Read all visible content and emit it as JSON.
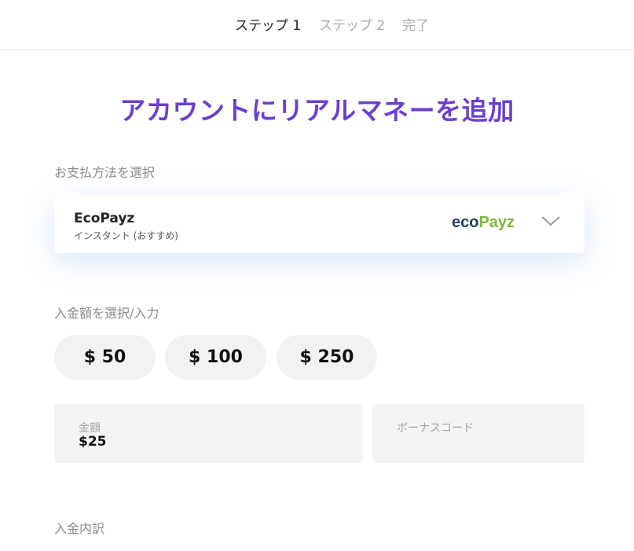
{
  "steps": [
    {
      "label": "ステップ 1",
      "active": true
    },
    {
      "label": "ステップ 2",
      "active": false
    },
    {
      "label": "完了",
      "active": false
    }
  ],
  "title": "アカウントにリアルマネーを追加",
  "payment": {
    "section_label": "お支払方法を選択",
    "method_name": "EcoPayz",
    "method_sub": "インスタント (おすすめ)",
    "brand_logo": {
      "part1": "eco",
      "part2": "Payz",
      "color1": "#1d3f6e",
      "color2": "#7cb83a"
    }
  },
  "amount": {
    "section_label": "入金額を選択/入力",
    "presets": [
      "$ 50",
      "$ 100",
      "$ 250"
    ],
    "field_label": "金額",
    "field_value": "$25"
  },
  "bonus": {
    "placeholder": "ボーナスコード"
  },
  "breakdown_label": "入金内訳",
  "colors": {
    "accent": "#6b3fd0"
  }
}
